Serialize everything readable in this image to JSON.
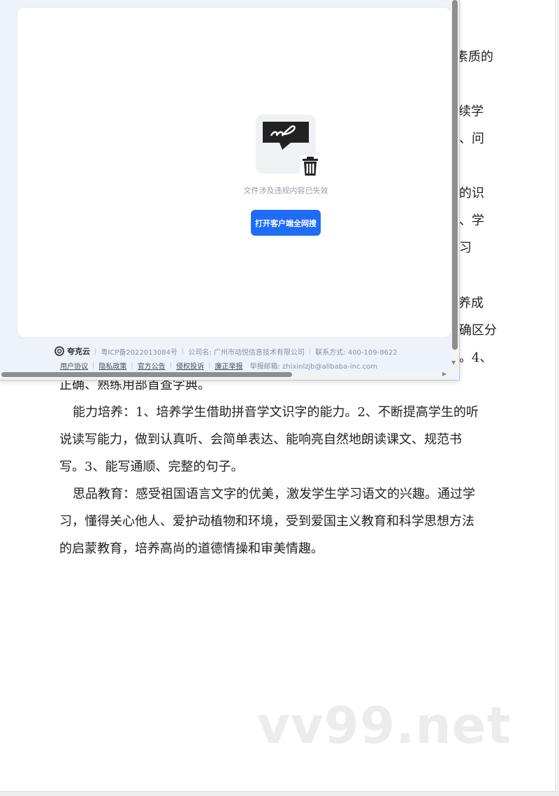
{
  "document": {
    "partial_lines": [
      {
        "id": "p1",
        "text": "素质的"
      },
      {
        "id": "p2",
        "text": "续学"
      },
      {
        "id": "p3",
        "text": "、问"
      },
      {
        "id": "p4",
        "text": "的识"
      },
      {
        "id": "p5",
        "text": "、学"
      },
      {
        "id": "p6",
        "text": "习"
      },
      {
        "id": "p7",
        "text": "养成"
      },
      {
        "id": "p8",
        "text": "确区分"
      },
      {
        "id": "p9",
        "text": "。4、"
      }
    ],
    "lines": [
      "正确、熟练用部首查字典。",
      "能力培养：1、培养学生借助拼音学文识字的能力。2、不断提高学生的听",
      "说读写能力，做到认真听、会简单表达、能响亮自然地朗读课文、规范书",
      "写。3、能写通顺、完整的句子。",
      "思品教育：感受祖国语言文字的优美，激发学生学习语文的兴趣。通过学",
      "习，懂得关心他人、爱护动植物和环境，受到爱国主义教育和科学思想方法",
      "的启蒙教育，培养高尚的道德情操和审美情趣。"
    ],
    "watermark": "vv99.net"
  },
  "popup": {
    "error_message": "文件涉及违规内容已失效",
    "open_button_label": "打开客户端全网搜",
    "file_icon": "file-invalid-icon",
    "delete_icon": "trash-icon",
    "footer": {
      "brand": "夸克云",
      "icp": "粤ICP备2022013084号",
      "company": "公司名: 广州市动悦信息技术有限公司",
      "contact": "联系方式: 400-109-8622",
      "links": [
        "用户协议",
        "隐私政策",
        "官方公告",
        "侵权投诉",
        "廉正举报"
      ],
      "report_email": "举报邮箱: zhixinlzjb@alibaba-inc.com"
    }
  },
  "colors": {
    "accent": "#1f6cf5",
    "panel_bg": "#eef2f9",
    "text": "#222222"
  }
}
